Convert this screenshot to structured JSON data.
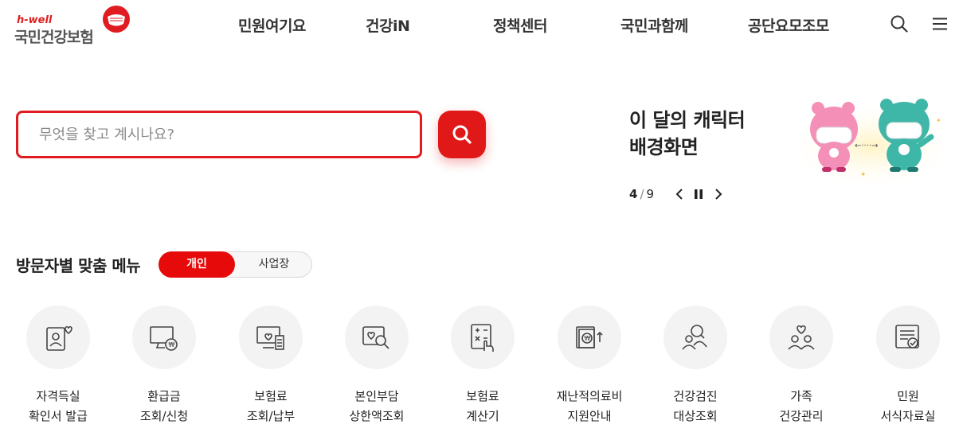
{
  "logo": {
    "brand_small": "h-well",
    "brand_main": "국민건강보험"
  },
  "nav": {
    "items": [
      "민원여기요",
      "건강iN",
      "정책센터",
      "국민과함께",
      "공단요모조모"
    ]
  },
  "header_icons": [
    "search-icon",
    "menu-icon"
  ],
  "search": {
    "placeholder": "무엇을 찾고 계시나요?"
  },
  "character": {
    "title_line1": "이 달의 캐릭터",
    "title_line2": "배경화면",
    "pager_current": "4",
    "pager_sep": "/",
    "pager_total": "9"
  },
  "visitor_menu": {
    "title": "방문자별 맞춤 메뉴",
    "toggle": {
      "active": "개인",
      "inactive": "사업장"
    },
    "items": [
      {
        "line1": "자격득실",
        "line2": "확인서 발급",
        "icon": "id-card-heart-icon"
      },
      {
        "line1": "환급금",
        "line2": "조회/신청",
        "icon": "monitor-won-icon"
      },
      {
        "line1": "보험료",
        "line2": "조회/납부",
        "icon": "monitor-receipt-icon"
      },
      {
        "line1": "본인부담",
        "line2": "상한액조회",
        "icon": "heart-search-icon"
      },
      {
        "line1": "보험료",
        "line2": "계산기",
        "icon": "calculator-hand-icon"
      },
      {
        "line1": "재난적의료비",
        "line2": "지원안내",
        "icon": "won-support-icon"
      },
      {
        "line1": "건강검진",
        "line2": "대상조회",
        "icon": "people-search-icon"
      },
      {
        "line1": "가족",
        "line2": "건강관리",
        "icon": "family-heart-icon"
      },
      {
        "line1": "민원",
        "line2": "서식자료실",
        "icon": "document-check-icon"
      }
    ]
  },
  "colors": {
    "brand_red": "#e11b22",
    "toggle_red": "#e60a0a",
    "circle_bg": "#f3f3f3"
  }
}
